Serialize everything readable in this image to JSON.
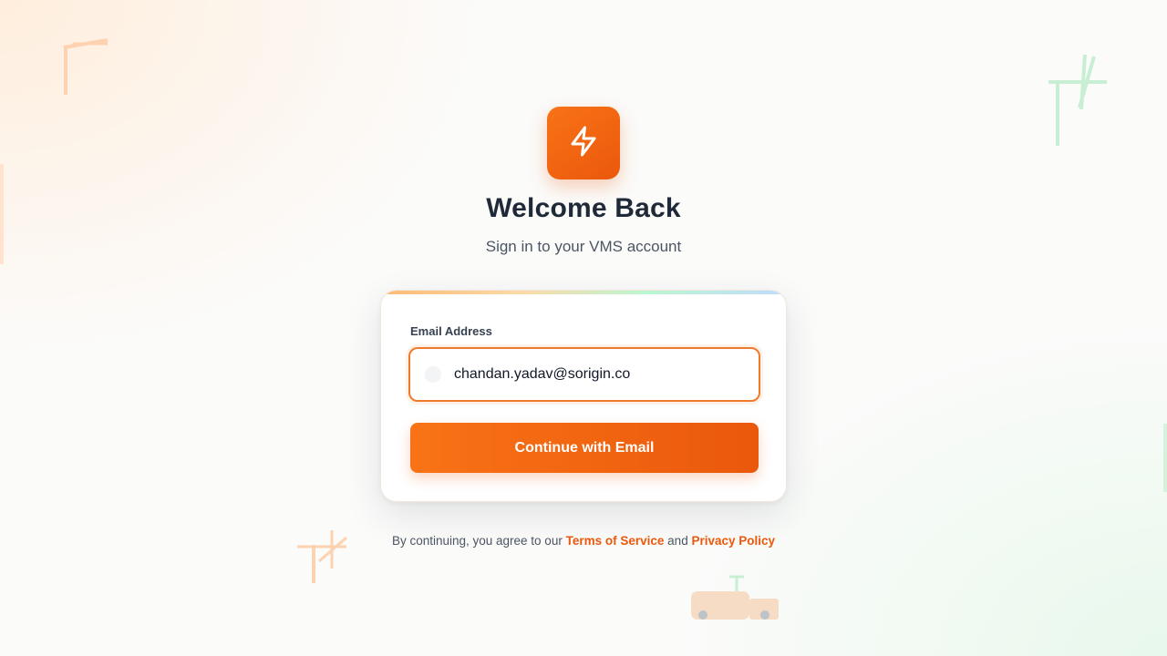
{
  "brand": {
    "logo_icon": "lightning-bolt-icon",
    "accent_color": "#f97316",
    "accent_dark": "#ea580c"
  },
  "header": {
    "title": "Welcome Back",
    "subtitle": "Sign in to your VMS account"
  },
  "form": {
    "email_label": "Email Address",
    "email_value": "chandan.yadav@sorigin.co",
    "email_icon": "mail-icon",
    "submit_label": "Continue with Email"
  },
  "legal": {
    "prefix": "By continuing, you agree to our",
    "terms_label": "Terms of Service",
    "conjunction": "and",
    "privacy_label": "Privacy Policy"
  },
  "decorations": {
    "icons": [
      "crane-icon",
      "utility-pole-icon",
      "utility-pole-icon",
      "truck-icon"
    ]
  }
}
